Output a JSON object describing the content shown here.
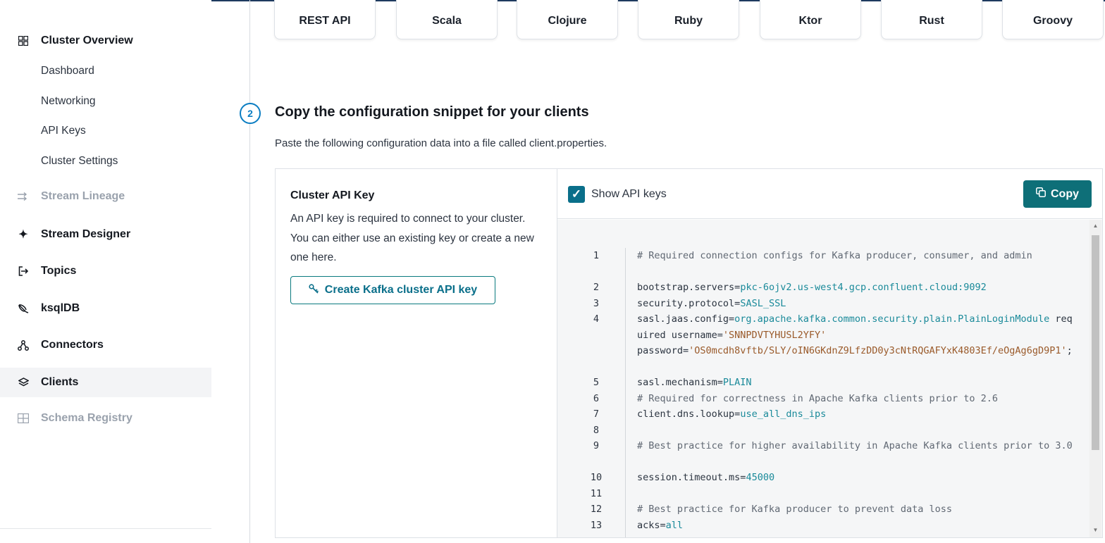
{
  "sidebar": {
    "cluster_overview": "Cluster Overview",
    "sub_items": [
      "Dashboard",
      "Networking",
      "API Keys",
      "Cluster Settings"
    ],
    "stream_lineage": "Stream Lineage",
    "stream_designer": "Stream Designer",
    "topics": "Topics",
    "ksqldb": "ksqlDB",
    "connectors": "Connectors",
    "clients": "Clients",
    "schema_registry": "Schema Registry"
  },
  "languages": [
    "REST API",
    "Scala",
    "Clojure",
    "Ruby",
    "Ktor",
    "Rust",
    "Groovy"
  ],
  "step": {
    "number": "2",
    "title": "Copy the configuration snippet for your clients",
    "description": "Paste the following configuration data into a file called client.properties."
  },
  "api_key_panel": {
    "title": "Cluster API Key",
    "description": "An API key is required to connect to your cluster. You can either use an existing key or create a new one here.",
    "create_button": "Create Kafka cluster API key"
  },
  "config": {
    "show_api_keys_label": "Show API keys",
    "show_api_keys_checked": true,
    "copy_button": "Copy",
    "lines": [
      {
        "n": "1",
        "type": "comment",
        "text": "# Required connection configs for Kafka producer, consumer, and admin"
      },
      {
        "n": "2",
        "type": "kv",
        "key": "bootstrap.servers=",
        "value": "pkc-6ojv2.us-west4.gcp.confluent.cloud:9092"
      },
      {
        "n": "3",
        "type": "kv",
        "key": "security.protocol=",
        "value": "SASL_SSL"
      },
      {
        "n": "4",
        "type": "jaas",
        "key": "sasl.jaas.config=",
        "value": "org.apache.kafka.common.security.plain.PlainLoginModule",
        "mid1": " required username=",
        "user": "'SNNPDVTYHUSL2YFY'",
        "mid2": " password=",
        "pass": "'OS0mcdh8vftb/SLY/oIN6GKdnZ9LfzDD0y3cNtRQGAFYxK4803Ef/eOgAg6gD9P1'",
        "end": ";"
      },
      {
        "n": "5",
        "type": "kv",
        "key": "sasl.mechanism=",
        "value": "PLAIN"
      },
      {
        "n": "6",
        "type": "comment",
        "text": "# Required for correctness in Apache Kafka clients prior to 2.6"
      },
      {
        "n": "7",
        "type": "kv",
        "key": "client.dns.lookup=",
        "value": "use_all_dns_ips"
      },
      {
        "n": "8",
        "type": "blank",
        "text": ""
      },
      {
        "n": "9",
        "type": "comment",
        "text": "# Best practice for higher availability in Apache Kafka clients prior to 3.0"
      },
      {
        "n": "10",
        "type": "kv",
        "key": "session.timeout.ms=",
        "value": "45000"
      },
      {
        "n": "11",
        "type": "blank",
        "text": ""
      },
      {
        "n": "12",
        "type": "comment",
        "text": "# Best practice for Kafka producer to prevent data loss"
      },
      {
        "n": "13",
        "type": "kv",
        "key": "acks=",
        "value": "all"
      }
    ]
  }
}
